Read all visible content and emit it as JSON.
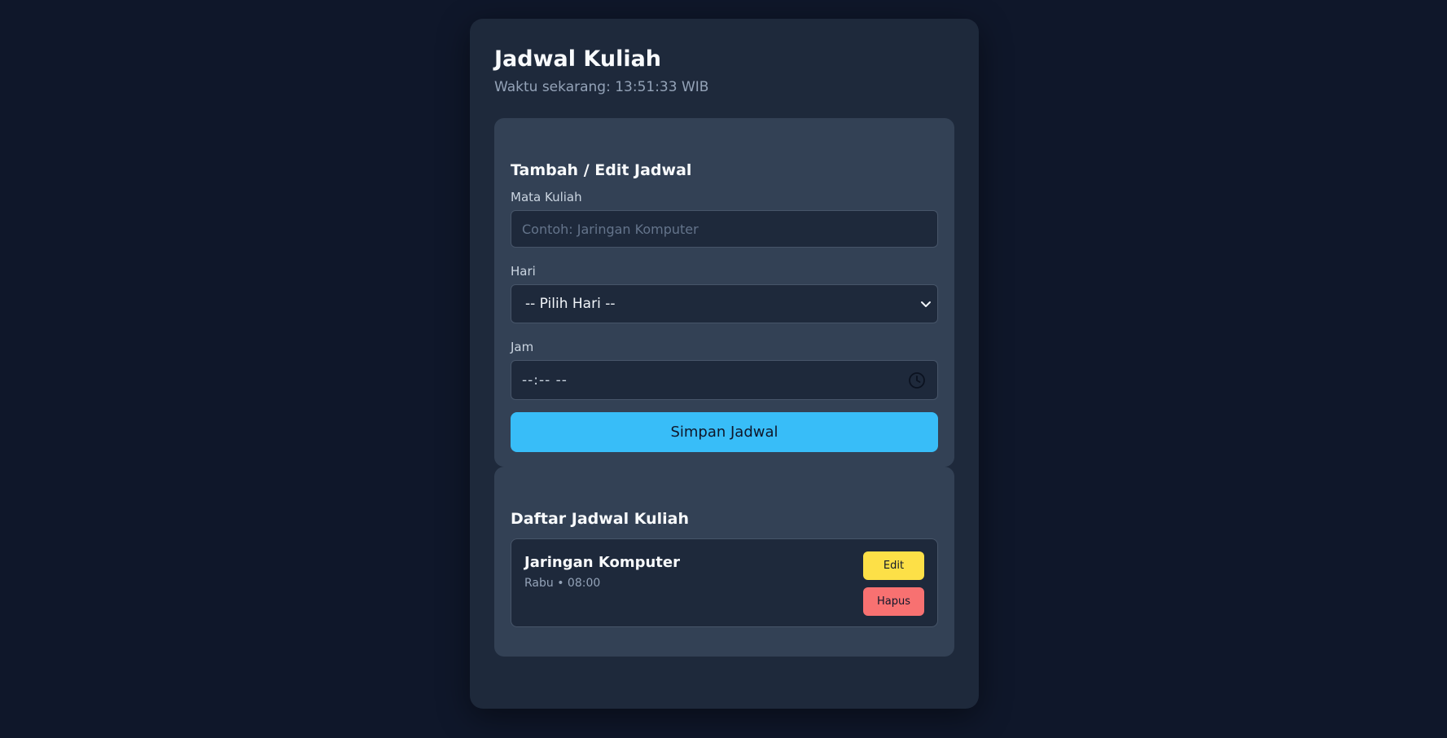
{
  "header": {
    "title": "Jadwal Kuliah",
    "clock_text": "Waktu sekarang: 13:51:33 WIB"
  },
  "form": {
    "title": "Tambah / Edit Jadwal",
    "course_label": "Mata Kuliah",
    "course_placeholder": "Contoh: Jaringan Komputer",
    "course_value": "",
    "day_label": "Hari",
    "day_selected": "-- Pilih Hari --",
    "time_label": "Jam",
    "time_value": "--:-- --",
    "save_label": "Simpan Jadwal"
  },
  "list": {
    "title": "Daftar Jadwal Kuliah",
    "items": [
      {
        "course": "Jaringan Komputer",
        "meta": "Rabu • 08:00",
        "edit_label": "Edit",
        "delete_label": "Hapus"
      }
    ]
  },
  "colors": {
    "background": "#0f172a",
    "card": "#1e293b",
    "panel": "#334155",
    "accent": "#38bdf8",
    "edit": "#fde047",
    "delete": "#f87171"
  },
  "icons": {
    "select_arrow": "chevron-down-icon",
    "time_picker": "clock-icon"
  }
}
